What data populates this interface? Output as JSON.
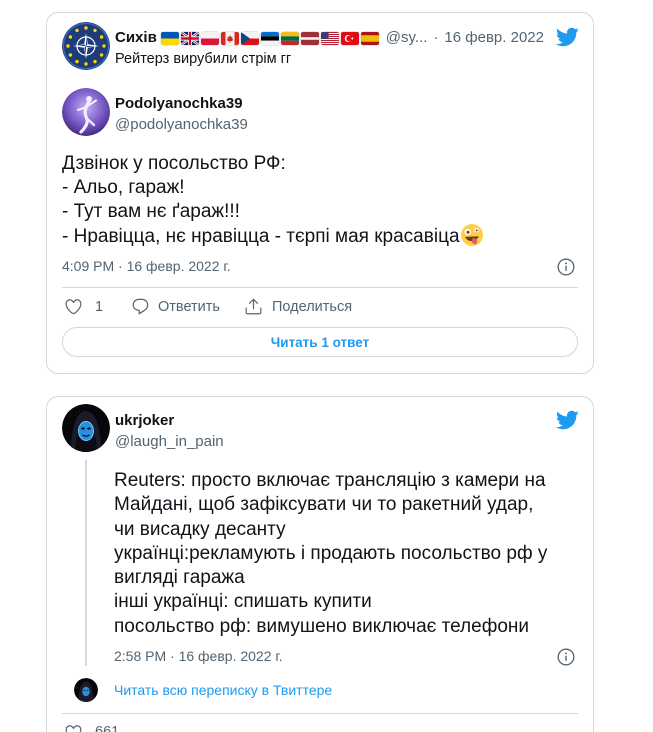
{
  "colors": {
    "text": "#0f1419",
    "secondary": "#536471",
    "border": "#cfd9de",
    "link": "#1d9bf0",
    "brand": "#1d9bf0"
  },
  "icons": {
    "brand": "twitter-bird",
    "like": "heart",
    "reply": "comment-bubble",
    "share": "share-arrow",
    "info": "info-circle"
  },
  "tweet_1": {
    "parent": {
      "avatar": "nato-star-ring-avatar",
      "author_name": "Сихів",
      "flags": [
        "ua",
        "gb",
        "pl",
        "ca",
        "cz",
        "ee",
        "lt",
        "lv",
        "us",
        "tr",
        "es"
      ],
      "handle": "@sy...",
      "separator": "·",
      "date": "16 февр. 2022 г.",
      "text": "Рейтерз вирубили стрім гг"
    },
    "avatar": "purple-dancer-avatar",
    "author_name": "Podolyanochka39",
    "handle": "@podolyanochka39",
    "text_lines": [
      "Дзвінок у посольство РФ:",
      "- Альо, гараж!",
      "- Тут вам нє ґараж!!!",
      "- Нравіцца, нє нравіцца - тєрпі мая красавіца"
    ],
    "text_emoji": "zany-face",
    "timestamp": "4:09 PM · 16 февр. 2022 г.",
    "likes": "1",
    "reply_label": "Ответить",
    "share_label": "Поделиться",
    "read_replies_label": "Читать 1 ответ"
  },
  "tweet_2": {
    "avatar": "hooded-blue-mask-avatar",
    "author_name": "ukrjoker",
    "handle": "@laugh_in_pain",
    "text_lines": [
      "Reuters: просто включає трансляцію з камери на",
      "Майдані, щоб зафіксувати чи то ракетний удар,",
      "чи висадку десанту",
      "українці:рекламують і продають посольство рф у",
      "вигляді гаража",
      "інші українці: спишать купити",
      "посольство рф: вимушено виключає телефони"
    ],
    "timestamp": "2:58 PM · 16 февр. 2022 г.",
    "read_conversation_label": "Читать всю переписку в Твиттере",
    "likes": "661"
  }
}
